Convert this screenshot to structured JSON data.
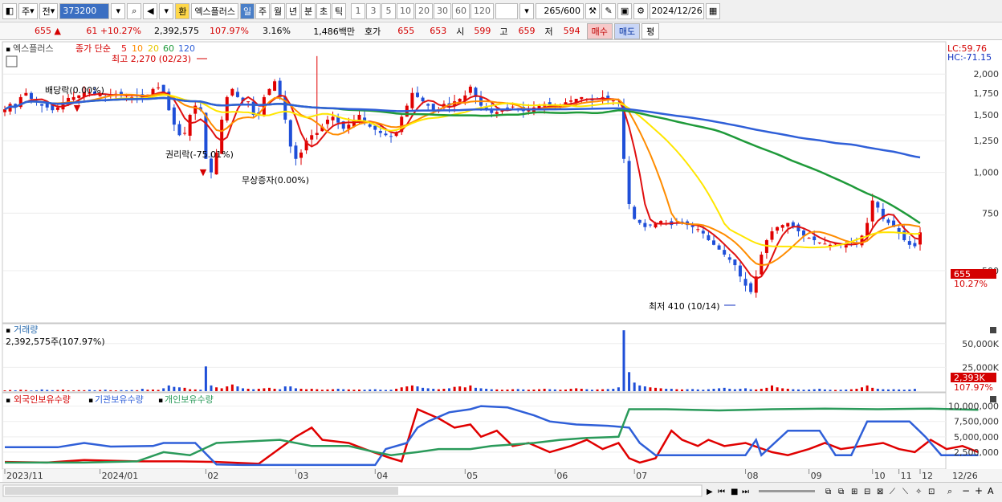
{
  "toolbar": {
    "period_label": "주",
    "all_label": "전",
    "stock_code": "373200",
    "currency_label": "환",
    "stock_name": "엑스플러스",
    "periods": [
      "일",
      "주",
      "월",
      "년",
      "분",
      "초",
      "틱"
    ],
    "active_period": "일",
    "minute_options": [
      "1",
      "3",
      "5",
      "10",
      "20",
      "30",
      "60",
      "120"
    ],
    "count_display": "265",
    "count_total": "/600",
    "date": "2024/12/26"
  },
  "quote": {
    "price": "655",
    "change_arrow": "▲",
    "change": "61",
    "change_pct": "+10.27%",
    "volume": "2,392,575",
    "volume_ratio": "107.97%",
    "turnover": "3.16%",
    "amount": "1,486백만",
    "hoga_label": "호가",
    "ask": "655",
    "bid": "653",
    "open_label": "시",
    "open": "599",
    "high_label": "고",
    "high": "659",
    "low_label": "저",
    "low": "594",
    "buy_label": "매수",
    "sell_label": "매도",
    "eval_label": "평"
  },
  "price_panel": {
    "name_tag": "엑스플러스",
    "ma_legend": {
      "prefix": "종가 단순",
      "periods": [
        "5",
        "10",
        "20",
        "60",
        "120"
      ]
    },
    "lc": "LC:59.76",
    "hc": "HC:-71.15",
    "current_price_tag": "655",
    "current_pct_tag": "10.27%",
    "annotations": {
      "high": "최고 2,270 (02/23)",
      "low": "최저 410 (10/14)",
      "dividend": "배당락(0.00%)",
      "rights": "권리락(-75.01%)",
      "bonus": "무상증자(0.00%)"
    }
  },
  "volume_panel": {
    "title": "거래량",
    "value_label": "2,392,575주(107.97%)",
    "current_tag": "2,393K",
    "current_pct": "107.97%"
  },
  "holdings_panel": {
    "labels": [
      "외국인보유수량",
      "기관보유수량",
      "개인보유수량"
    ]
  },
  "x_axis": {
    "labels": [
      "2023/11",
      "2024/01",
      "02",
      "03",
      "04",
      "05",
      "06",
      "07",
      "08",
      "09",
      "10",
      "11",
      "12"
    ],
    "last_date": "12/26"
  },
  "colors": {
    "up": "#e00000",
    "down": "#1f4fd8",
    "ma5": "#e01010",
    "ma10": "#ff8c00",
    "ma20": "#ffe600",
    "ma60": "#1f9a3a",
    "ma120": "#2f5fd8",
    "foreign": "#e00000",
    "institution": "#2f5fd8",
    "individual": "#2a9a5a"
  },
  "chart_data": [
    {
      "type": "candlestick",
      "title": "엑스플러스",
      "y_ticks": [
        500,
        750,
        1000,
        1250,
        1500,
        1750,
        2000
      ],
      "ylim": [
        350,
        2400
      ],
      "x_range": [
        "2023/11",
        "2024/12/26"
      ],
      "events": {
        "high": {
          "value": 2270,
          "date": "02/23"
        },
        "low": {
          "value": 410,
          "date": "10/14"
        }
      },
      "close": [
        1560,
        1620,
        1580,
        1700,
        1750,
        1680,
        1640,
        1600,
        1580,
        1550,
        1580,
        1640,
        1690,
        1700,
        1720,
        1760,
        1750,
        1730,
        1740,
        1700,
        1720,
        1740,
        1730,
        1720,
        1700,
        1710,
        1690,
        1730,
        1800,
        1820,
        1760,
        1550,
        1400,
        1300,
        1320,
        1500,
        1600,
        1550,
        1100,
        1000,
        1150,
        1450,
        1700,
        1800,
        1700,
        1650,
        1650,
        1500,
        1500,
        1700,
        1800,
        1900,
        1700,
        1450,
        1200,
        1100,
        1150,
        1250,
        1300,
        1320,
        1380,
        1450,
        1480,
        1420,
        1360,
        1400,
        1450,
        1500,
        1430,
        1380,
        1350,
        1320,
        1300,
        1290,
        1330,
        1480,
        1600,
        1750,
        1700,
        1650,
        1600,
        1550,
        1560,
        1620,
        1600,
        1650,
        1680,
        1720,
        1830,
        1700,
        1600,
        1550,
        1520,
        1530,
        1560,
        1580,
        1590,
        1560,
        1540,
        1550,
        1580,
        1600,
        1620,
        1610,
        1590,
        1600,
        1640,
        1660,
        1680,
        1700,
        1680,
        1660,
        1670,
        1700,
        1690,
        1660,
        1620,
        1100,
        800,
        720,
        700,
        680,
        690,
        700,
        710,
        700,
        690,
        700,
        700,
        690,
        680,
        670,
        650,
        620,
        600,
        580,
        560,
        540,
        520,
        480,
        450,
        430,
        480,
        560,
        620,
        660,
        680,
        690,
        700,
        680,
        660,
        640,
        630,
        620,
        610,
        605,
        600,
        605,
        600,
        598,
        602,
        610,
        640,
        700,
        820,
        780,
        720,
        700,
        680,
        650,
        620,
        600,
        594,
        655
      ],
      "series": [
        {
          "name": "5",
          "values": []
        },
        {
          "name": "10",
          "values": []
        },
        {
          "name": "20",
          "values": []
        },
        {
          "name": "60",
          "values": []
        },
        {
          "name": "120",
          "values": []
        }
      ]
    },
    {
      "type": "bar",
      "title": "거래량",
      "y_ticks": [
        "25,000K",
        "50,000K"
      ],
      "ylim": [
        0,
        65000
      ],
      "values": [
        800,
        1200,
        900,
        1500,
        1100,
        700,
        900,
        1800,
        1300,
        1000,
        1200,
        1600,
        900,
        800,
        1100,
        1000,
        1400,
        900,
        1200,
        1500,
        1000,
        800,
        1100,
        900,
        1200,
        1000,
        2500,
        1500,
        1700,
        1300,
        3000,
        6000,
        4500,
        4000,
        3500,
        2000,
        1800,
        1500,
        26000,
        6000,
        4000,
        3000,
        5000,
        7000,
        5000,
        3000,
        2500,
        2000,
        2500,
        3000,
        3500,
        2500,
        2000,
        5000,
        5000,
        3000,
        2500,
        2000,
        2500,
        2000,
        1500,
        1800,
        2000,
        2500,
        2000,
        1800,
        1500,
        1700,
        1500,
        1800,
        2000,
        1500,
        1300,
        1500,
        2500,
        4000,
        5000,
        6000,
        5000,
        3500,
        3000,
        2500,
        2000,
        2500,
        3000,
        4500,
        5000,
        4000,
        6000,
        3500,
        3000,
        2500,
        2000,
        1800,
        1500,
        1700,
        2000,
        2200,
        1800,
        1500,
        1700,
        2000,
        2500,
        2000,
        1800,
        1500,
        1700,
        2500,
        3000,
        2500,
        2000,
        1500,
        1800,
        2000,
        2200,
        2500,
        4000,
        64000,
        20000,
        9000,
        6000,
        5000,
        4000,
        3500,
        3000,
        2500,
        2500,
        2000,
        1800,
        2000,
        2200,
        1800,
        1500,
        2000,
        2500,
        3000,
        3500,
        2500,
        2000,
        2500,
        3000,
        2000,
        1800,
        2500,
        3500,
        6000,
        4000,
        3000,
        2500,
        2000,
        1800,
        1500,
        1700,
        2000,
        2500,
        1800,
        1500,
        1300,
        1500,
        1700,
        2000,
        2500,
        4000,
        6000,
        3500,
        2500,
        2000,
        1800,
        2000,
        1800,
        1500,
        1800,
        2393
      ]
    },
    {
      "type": "line",
      "title": "",
      "y_ticks": [
        "2,500,000",
        "5,000,000",
        "7,500,000",
        "10,000,000"
      ],
      "ylim": [
        0,
        11000000
      ],
      "series": [
        {
          "name": "외국인보유수량",
          "points": [
            [
              0,
              0.9
            ],
            [
              8,
              0.8
            ],
            [
              15,
              1.2
            ],
            [
              25,
              1.0
            ],
            [
              33,
              1.0
            ],
            [
              40,
              0.9
            ],
            [
              48,
              0.6
            ],
            [
              55,
              5.0
            ],
            [
              58,
              6.5
            ],
            [
              60,
              4.5
            ],
            [
              65,
              4.0
            ],
            [
              68,
              3.0
            ],
            [
              73,
              1.5
            ],
            [
              75,
              1.0
            ],
            [
              78,
              9.5
            ],
            [
              82,
              8.0
            ],
            [
              85,
              6.5
            ],
            [
              88,
              7.0
            ],
            [
              90,
              5.0
            ],
            [
              93,
              6.0
            ],
            [
              96,
              3.5
            ],
            [
              99,
              4.0
            ],
            [
              103,
              2.5
            ],
            [
              107,
              3.5
            ],
            [
              110,
              4.5
            ],
            [
              113,
              3.0
            ],
            [
              116,
              4.0
            ],
            [
              118,
              1.5
            ],
            [
              120,
              0.8
            ],
            [
              123,
              1.5
            ],
            [
              126,
              6.0
            ],
            [
              128,
              4.5
            ],
            [
              131,
              3.5
            ],
            [
              133,
              4.5
            ],
            [
              136,
              3.5
            ],
            [
              140,
              4.0
            ],
            [
              145,
              2.5
            ],
            [
              148,
              2.0
            ],
            [
              152,
              3.0
            ],
            [
              155,
              4.0
            ],
            [
              158,
              3.0
            ],
            [
              162,
              3.5
            ],
            [
              166,
              4.0
            ],
            [
              169,
              3.0
            ],
            [
              172,
              2.5
            ],
            [
              175,
              4.5
            ],
            [
              178,
              3.0
            ],
            [
              181,
              3.5
            ],
            [
              184,
              2.5
            ]
          ]
        },
        {
          "name": "기관보유수량",
          "points": [
            [
              0,
              3.3
            ],
            [
              10,
              3.3
            ],
            [
              15,
              4.0
            ],
            [
              20,
              3.4
            ],
            [
              28,
              3.5
            ],
            [
              30,
              4.0
            ],
            [
              36,
              4.0
            ],
            [
              40,
              0.5
            ],
            [
              45,
              0.4
            ],
            [
              55,
              0.4
            ],
            [
              65,
              0.4
            ],
            [
              70,
              0.4
            ],
            [
              72,
              3.0
            ],
            [
              76,
              4.0
            ],
            [
              78,
              6.5
            ],
            [
              80,
              7.5
            ],
            [
              84,
              9.0
            ],
            [
              88,
              9.5
            ],
            [
              90,
              10.0
            ],
            [
              95,
              9.8
            ],
            [
              100,
              8.5
            ],
            [
              103,
              7.5
            ],
            [
              108,
              7.0
            ],
            [
              114,
              6.8
            ],
            [
              118,
              6.5
            ],
            [
              120,
              4.0
            ],
            [
              123,
              2.0
            ],
            [
              130,
              2.0
            ],
            [
              136,
              2.0
            ],
            [
              140,
              2.0
            ],
            [
              142,
              4.5
            ],
            [
              143,
              2.0
            ],
            [
              148,
              6.0
            ],
            [
              154,
              6.0
            ],
            [
              157,
              2.0
            ],
            [
              160,
              2.0
            ],
            [
              163,
              7.5
            ],
            [
              167,
              7.5
            ],
            [
              171,
              7.5
            ],
            [
              174,
              5.0
            ],
            [
              177,
              2.0
            ],
            [
              184,
              2.0
            ]
          ]
        },
        {
          "name": "개인보유수량",
          "points": [
            [
              0,
              0.8
            ],
            [
              15,
              0.8
            ],
            [
              25,
              1.0
            ],
            [
              30,
              2.5
            ],
            [
              35,
              2.0
            ],
            [
              40,
              4.0
            ],
            [
              45,
              4.2
            ],
            [
              52,
              4.5
            ],
            [
              58,
              3.5
            ],
            [
              65,
              3.5
            ],
            [
              70,
              2.5
            ],
            [
              73,
              2.0
            ],
            [
              78,
              2.5
            ],
            [
              82,
              3.0
            ],
            [
              88,
              3.0
            ],
            [
              92,
              3.5
            ],
            [
              100,
              4.0
            ],
            [
              105,
              4.5
            ],
            [
              110,
              4.8
            ],
            [
              116,
              5.0
            ],
            [
              118,
              9.5
            ],
            [
              125,
              9.5
            ],
            [
              135,
              9.3
            ],
            [
              145,
              9.5
            ],
            [
              155,
              9.6
            ],
            [
              165,
              9.5
            ],
            [
              175,
              9.6
            ],
            [
              184,
              9.4
            ]
          ]
        }
      ]
    }
  ]
}
